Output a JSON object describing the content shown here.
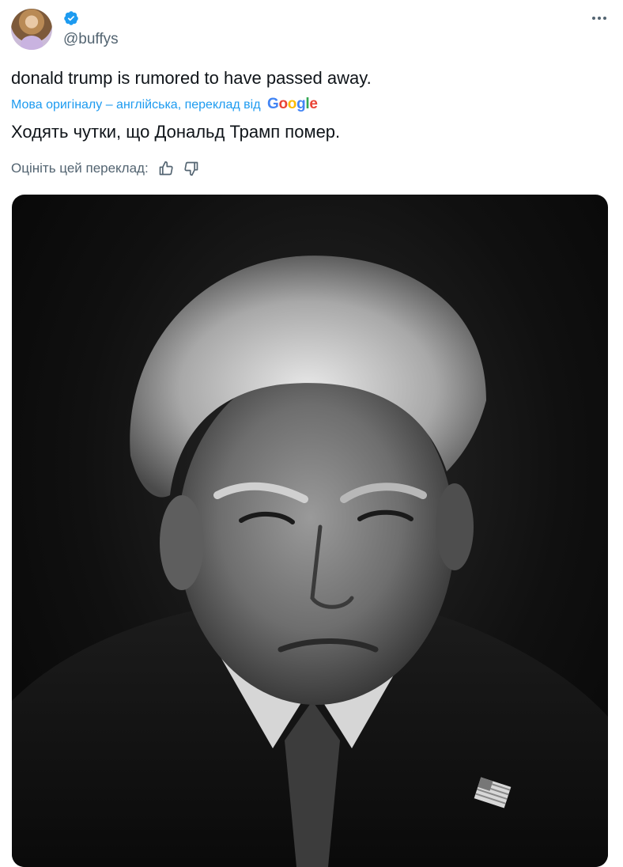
{
  "tweet": {
    "handle": "@buffys",
    "text": "donald trump is rumored to have passed away.",
    "translation_note": "Мова оригіналу – англійська, переклад від",
    "translation_provider": "Google",
    "translated_text": "Ходять чутки, що Дональд Трамп помер.",
    "rate_label": "Оцініть цей переклад:"
  },
  "icons": {
    "verified": "verified-badge-icon",
    "more": "more-options-icon",
    "thumbs_up": "thumbs-up-icon",
    "thumbs_down": "thumbs-down-icon"
  },
  "colors": {
    "accent": "#1d9bf0",
    "secondary_text": "#536471",
    "primary_text": "#0f1419"
  }
}
